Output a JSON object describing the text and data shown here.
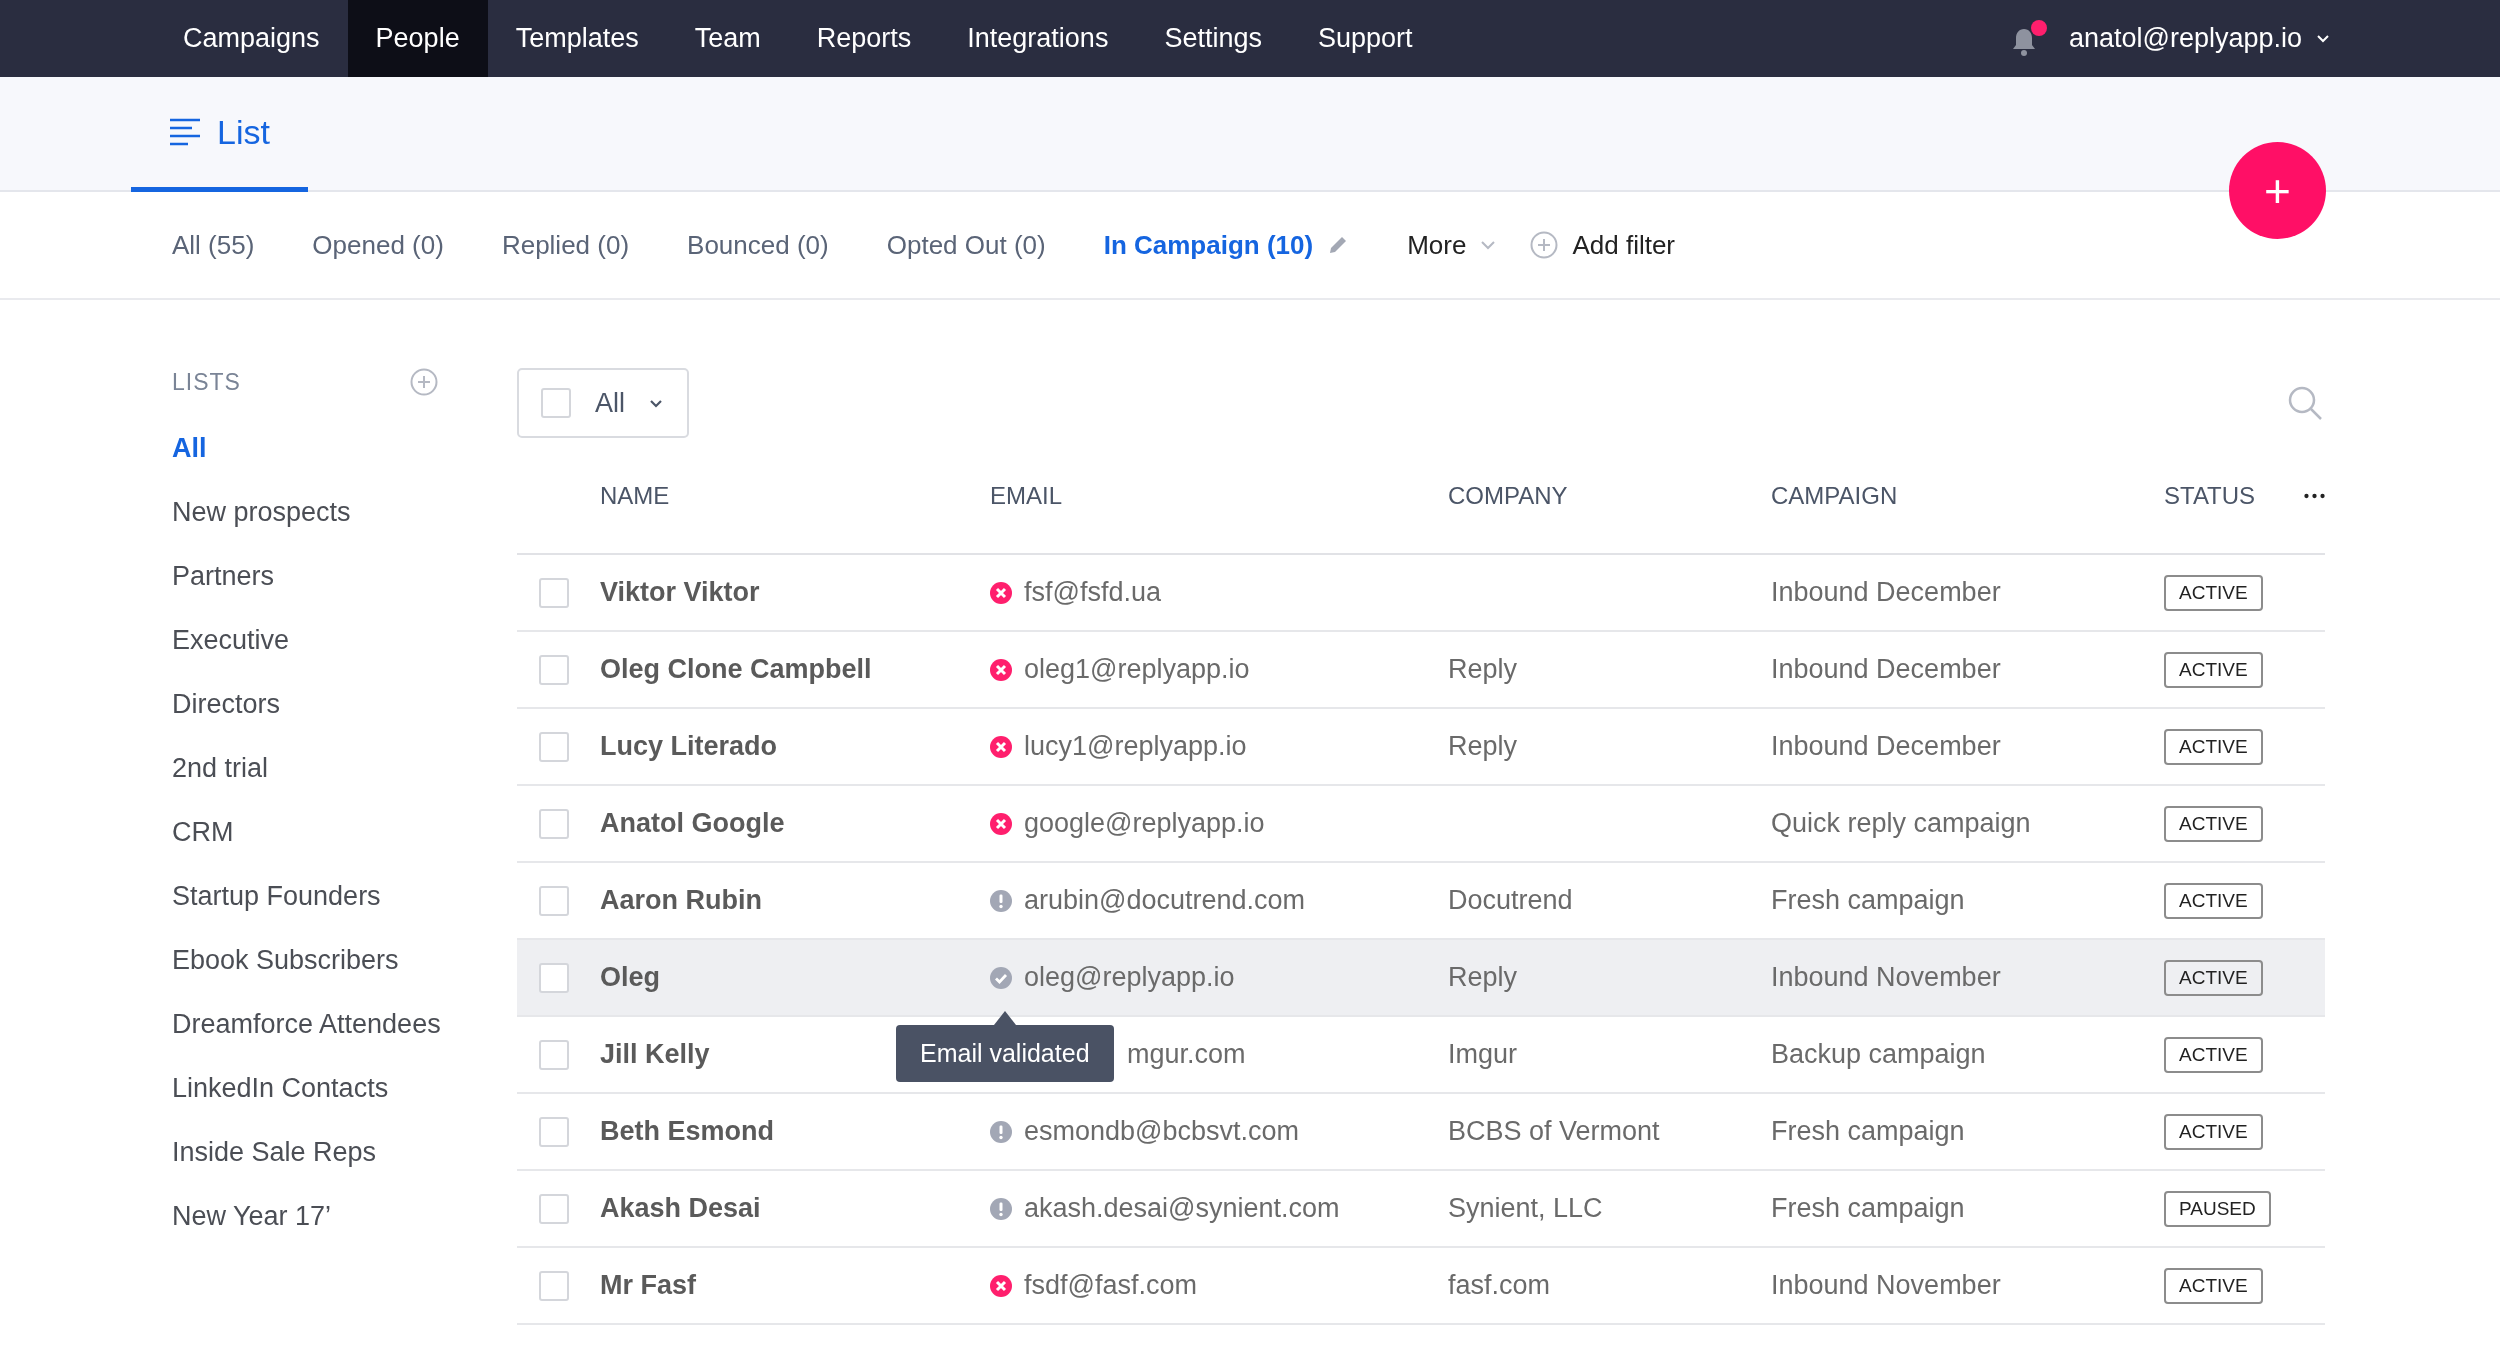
{
  "nav": {
    "items": [
      {
        "label": "Campaigns",
        "selected": false
      },
      {
        "label": "People",
        "selected": true
      },
      {
        "label": "Templates",
        "selected": false
      },
      {
        "label": "Team",
        "selected": false
      },
      {
        "label": "Reports",
        "selected": false
      },
      {
        "label": "Integrations",
        "selected": false
      },
      {
        "label": "Settings",
        "selected": false
      },
      {
        "label": "Support",
        "selected": false
      }
    ],
    "notification_unread": true,
    "user": "anatol@replyapp.io"
  },
  "view_tab": {
    "label": "List",
    "selected": true
  },
  "add_button": "+",
  "filters": [
    {
      "kind": "tab",
      "label": "All (55)",
      "selected": false
    },
    {
      "kind": "tab",
      "label": "Opened (0)",
      "selected": false
    },
    {
      "kind": "tab",
      "label": "Replied (0)",
      "selected": false
    },
    {
      "kind": "tab",
      "label": "Bounced (0)",
      "selected": false
    },
    {
      "kind": "tab",
      "label": "Opted Out (0)",
      "selected": false
    },
    {
      "kind": "tab",
      "label": "In Campaign (10)",
      "selected": true
    },
    {
      "kind": "dropdown",
      "label": "More",
      "selected": false
    },
    {
      "kind": "add",
      "label": "Add filter",
      "selected": false
    }
  ],
  "sidebar": {
    "heading": "LISTS",
    "items": [
      {
        "label": "All",
        "selected": true
      },
      {
        "label": "New prospects",
        "selected": false
      },
      {
        "label": "Partners",
        "selected": false
      },
      {
        "label": "Executive",
        "selected": false
      },
      {
        "label": "Directors",
        "selected": false
      },
      {
        "label": "2nd trial",
        "selected": false
      },
      {
        "label": "CRM",
        "selected": false
      },
      {
        "label": "Startup Founders",
        "selected": false
      },
      {
        "label": "Ebook Subscribers",
        "selected": false
      },
      {
        "label": "Dreamforce Attendees",
        "selected": false
      },
      {
        "label": "LinkedIn Contacts",
        "selected": false
      },
      {
        "label": "Inside Sale Reps",
        "selected": false
      },
      {
        "label": "New Year 17’",
        "selected": false
      }
    ]
  },
  "select_all": {
    "label": "All",
    "checked": false
  },
  "table": {
    "columns": [
      "NAME",
      "EMAIL",
      "COMPANY",
      "CAMPAIGN",
      "STATUS"
    ],
    "rows": [
      {
        "checked": false,
        "hovered": false,
        "name": "Viktor Viktor",
        "email_icon": {
          "kind": "invalid"
        },
        "email": "fsf@fsfd.ua",
        "company": "",
        "campaign": "Inbound December",
        "status": "ACTIVE"
      },
      {
        "checked": false,
        "hovered": false,
        "name": "Oleg Clone Campbell",
        "email_icon": {
          "kind": "invalid"
        },
        "email": "oleg1@replyapp.io",
        "company": "Reply",
        "campaign": "Inbound December",
        "status": "ACTIVE"
      },
      {
        "checked": false,
        "hovered": false,
        "name": "Lucy Literado",
        "email_icon": {
          "kind": "invalid"
        },
        "email": "lucy1@replyapp.io",
        "company": "Reply",
        "campaign": "Inbound December",
        "status": "ACTIVE"
      },
      {
        "checked": false,
        "hovered": false,
        "name": "Anatol Google",
        "email_icon": {
          "kind": "invalid"
        },
        "email": "google@replyapp.io",
        "company": "",
        "campaign": "Quick reply campaign",
        "status": "ACTIVE"
      },
      {
        "checked": false,
        "hovered": false,
        "name": "Aaron Rubin",
        "email_icon": {
          "kind": "unknown"
        },
        "email": "arubin@docutrend.com",
        "company": "Docutrend",
        "campaign": "Fresh campaign",
        "status": "ACTIVE"
      },
      {
        "checked": false,
        "hovered": true,
        "name": "Oleg",
        "email_icon": {
          "kind": "valid"
        },
        "email": "oleg@replyapp.io",
        "tooltip": "Email validated",
        "company": "Reply",
        "campaign": "Inbound November",
        "status": "ACTIVE"
      },
      {
        "checked": false,
        "hovered": false,
        "name": "Jill Kelly",
        "email_icon": {
          "kind": "covered"
        },
        "email": "mgur.com",
        "company": "Imgur",
        "campaign": "Backup campaign",
        "status": "ACTIVE"
      },
      {
        "checked": false,
        "hovered": false,
        "name": "Beth Esmond",
        "email_icon": {
          "kind": "unknown"
        },
        "email": "esmondb@bcbsvt.com",
        "company": "BCBS of Vermont",
        "campaign": "Fresh campaign",
        "status": "ACTIVE"
      },
      {
        "checked": false,
        "hovered": false,
        "name": "Akash Desai",
        "email_icon": {
          "kind": "unknown"
        },
        "email": "akash.desai@synient.com",
        "company": "Synient, LLC",
        "campaign": "Fresh campaign",
        "status": "PAUSED"
      },
      {
        "checked": false,
        "hovered": false,
        "name": "Mr Fasf",
        "email_icon": {
          "kind": "invalid"
        },
        "email": "fsdf@fasf.com",
        "company": "fasf.com",
        "campaign": "Inbound November",
        "status": "ACTIVE"
      }
    ]
  }
}
